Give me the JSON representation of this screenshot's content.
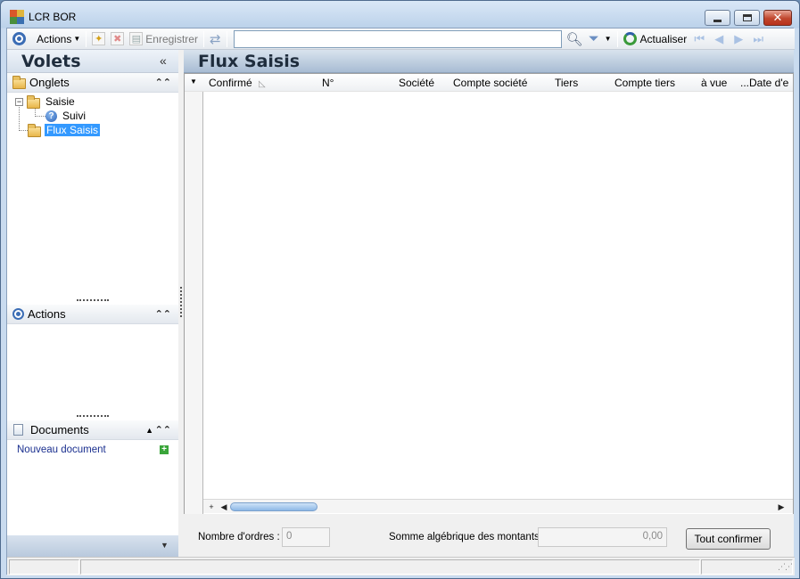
{
  "window": {
    "title": "LCR BOR"
  },
  "toolbar": {
    "actions_label": "Actions",
    "save_label": "Enregistrer",
    "search_value": "",
    "refresh_label": "Actualiser"
  },
  "volets": {
    "title": "Volets",
    "onglets_label": "Onglets",
    "tree": [
      {
        "label": "Saisie"
      },
      {
        "label": "Suivi"
      },
      {
        "label": "Flux Saisis"
      }
    ],
    "actions_label": "Actions",
    "documents_label": "Documents",
    "new_document_label": "Nouveau document"
  },
  "main": {
    "title": "Flux Saisis",
    "columns": [
      "Confirmé",
      "N°",
      "Société",
      "Compte société",
      "Tiers",
      "Compte tiers",
      "à vue",
      "...Date d'e"
    ]
  },
  "footer": {
    "orders_label": "Nombre d'ordres :",
    "orders_value": "0",
    "sum_label": "Somme algébrique des montants :",
    "sum_value": "0,00",
    "confirm_all_label": "Tout confirmer"
  },
  "colors": {
    "selection": "#3399ff",
    "accent": "#3b6db5"
  }
}
